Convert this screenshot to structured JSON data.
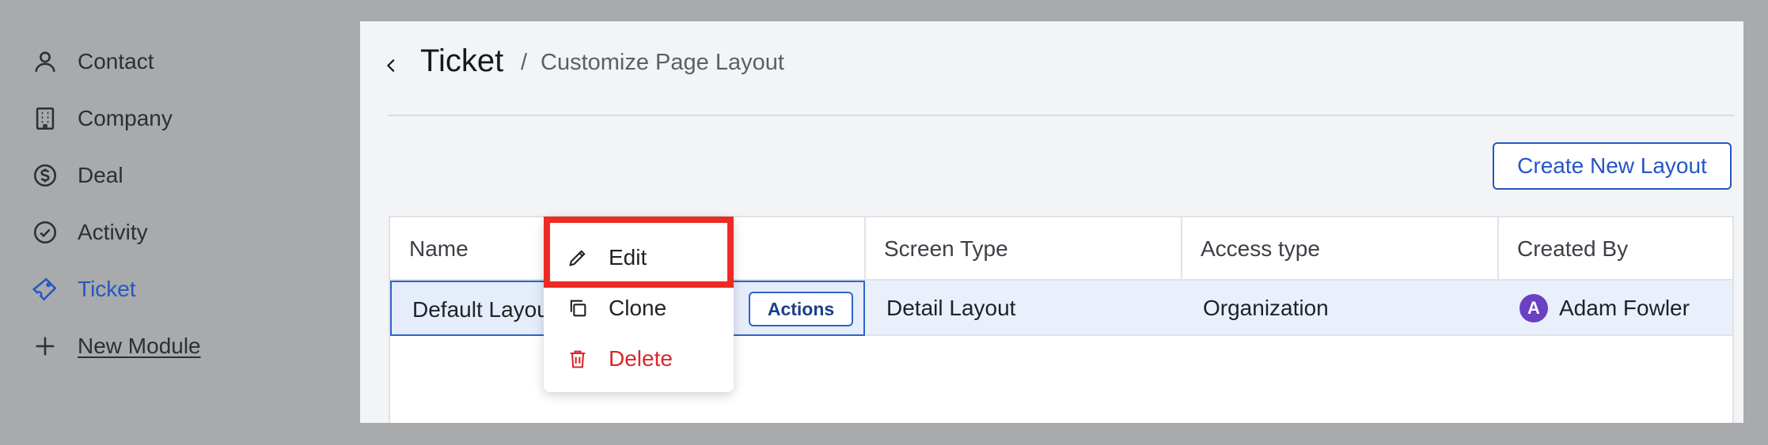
{
  "sidebar": {
    "items": [
      {
        "label": "Contact",
        "icon": "person-icon"
      },
      {
        "label": "Company",
        "icon": "building-icon"
      },
      {
        "label": "Deal",
        "icon": "dollar-circle-icon"
      },
      {
        "label": "Activity",
        "icon": "check-circle-icon"
      },
      {
        "label": "Ticket",
        "icon": "ticket-icon",
        "active": true
      },
      {
        "label": "New Module",
        "icon": "plus-icon"
      }
    ]
  },
  "header": {
    "title": "Ticket",
    "separator": "/",
    "breadcrumb": "Customize Page Layout"
  },
  "toolbar": {
    "create_label": "Create New Layout"
  },
  "table": {
    "columns": [
      "Name",
      "Screen Type",
      "Access type",
      "Created By"
    ],
    "rows": [
      {
        "name": "Default Layout",
        "actions_label": "Actions",
        "screen_type": "Detail Layout",
        "access_type": "Organization",
        "created_by": "Adam Fowler",
        "avatar_initial": "A"
      }
    ]
  },
  "menu": {
    "items": [
      {
        "label": "Edit",
        "icon": "pencil-icon"
      },
      {
        "label": "Clone",
        "icon": "copy-icon"
      },
      {
        "label": "Delete",
        "icon": "trash-icon"
      }
    ]
  },
  "colors": {
    "accent": "#2457c5",
    "danger": "#d9262c",
    "highlight": "#ee2a24",
    "avatar": "#6b40c2"
  }
}
